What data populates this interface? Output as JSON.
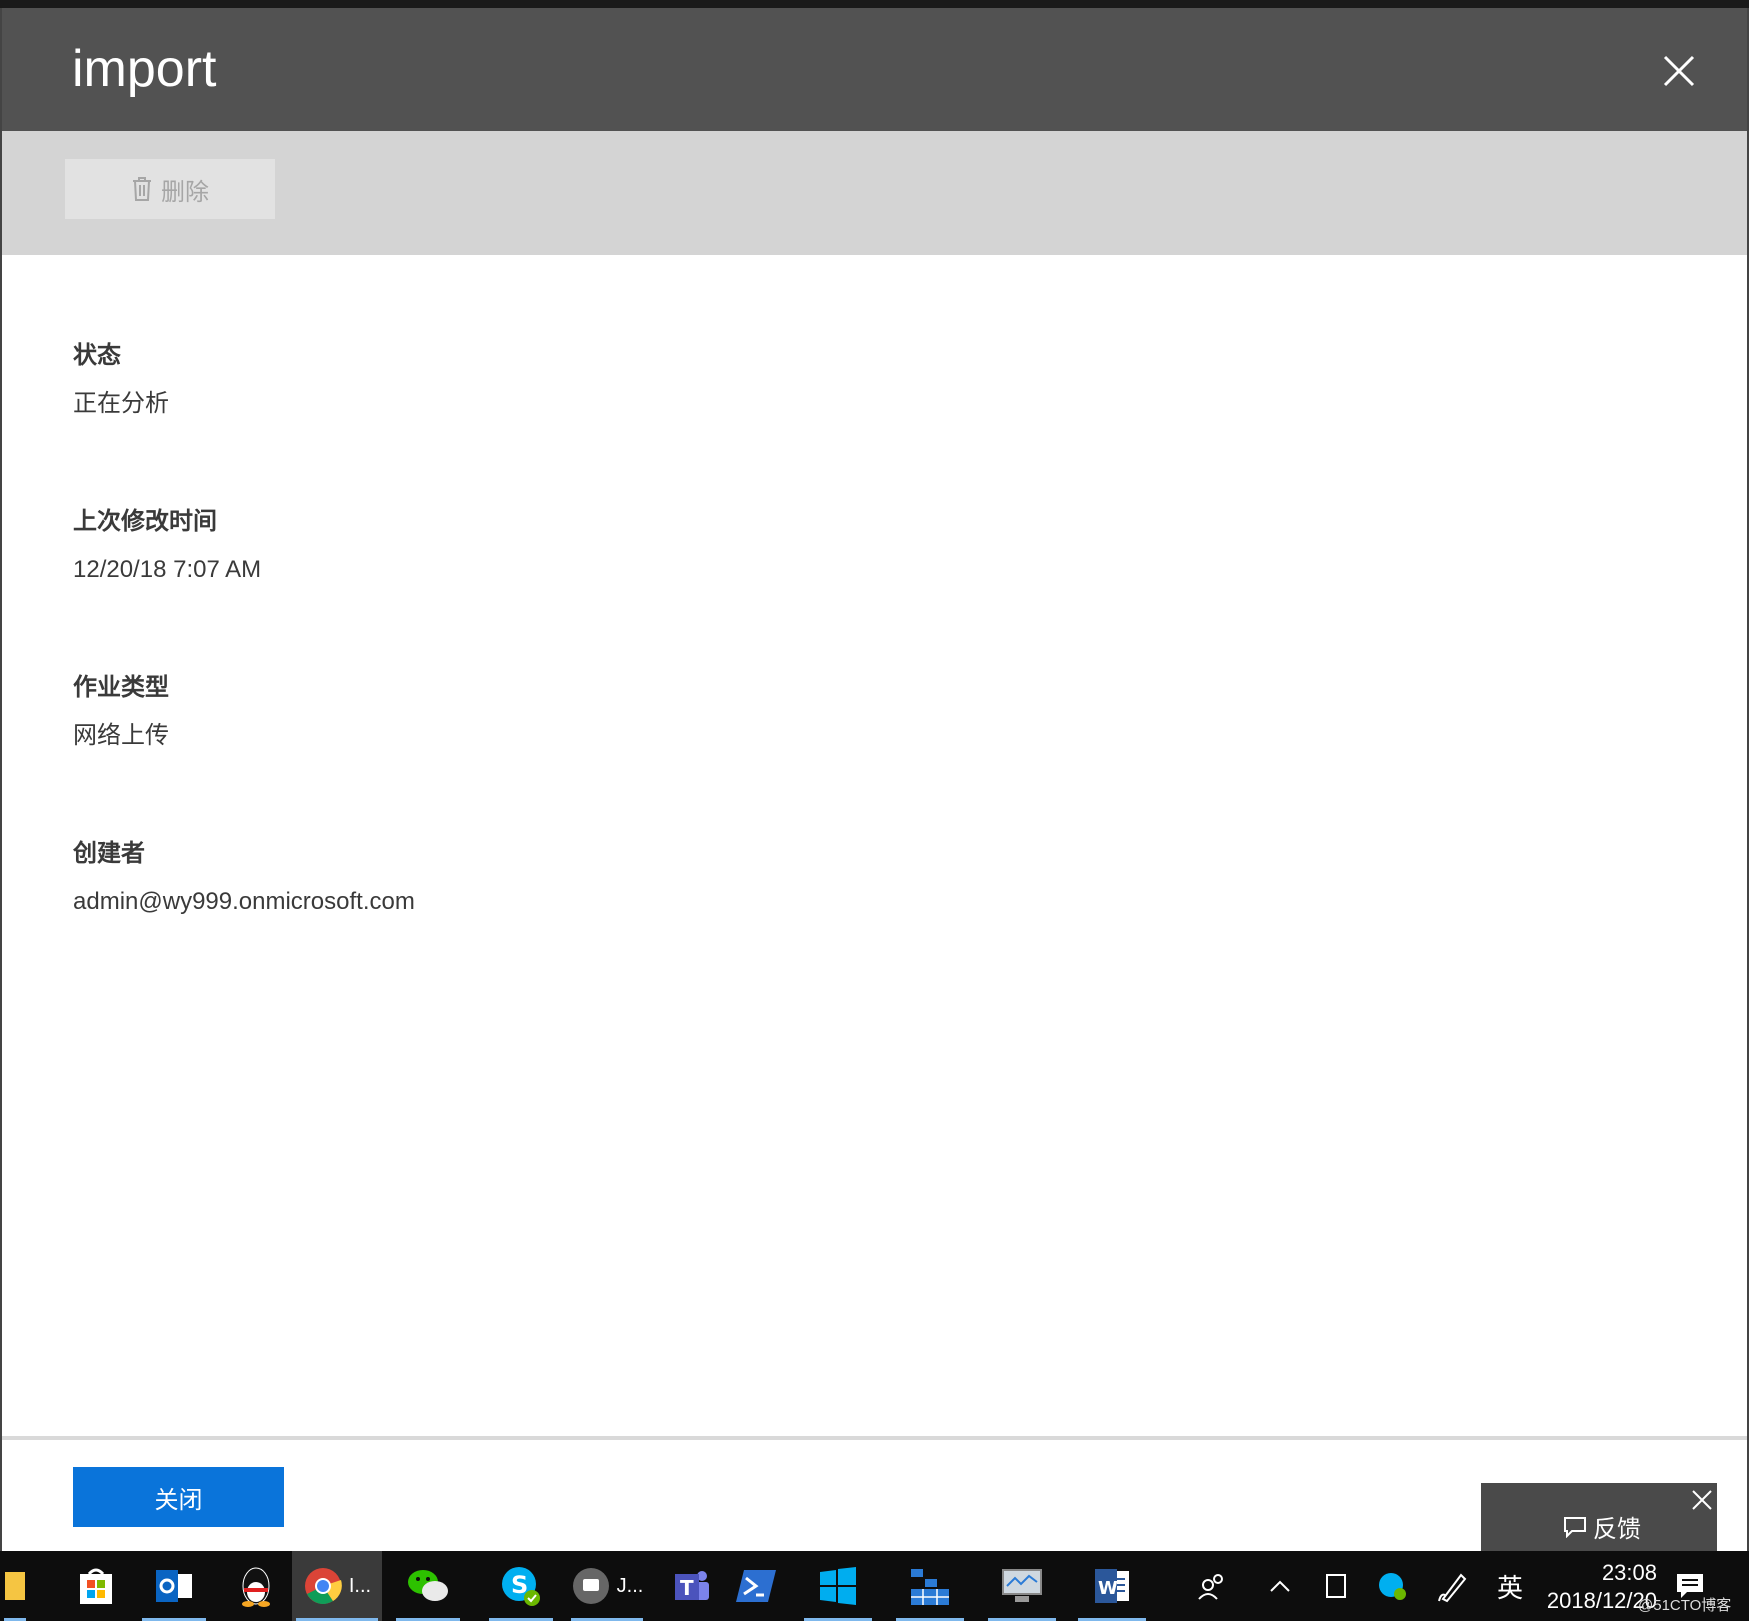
{
  "panel": {
    "title": "import",
    "toolbar": {
      "delete_label": "删除"
    },
    "fields": [
      {
        "label": "状态",
        "value": "正在分析"
      },
      {
        "label": "上次修改时间",
        "value": "12/20/18 7:07 AM"
      },
      {
        "label": "作业类型",
        "value": "网络上传"
      },
      {
        "label": "创建者",
        "value": "admin@wy999.onmicrosoft.com"
      }
    ],
    "close_button_label": "关闭",
    "feedback_label": "反馈"
  },
  "taskbar": {
    "chrome_label": "I...",
    "jabber_label": "J...",
    "ime_label": "英",
    "time": "23:08",
    "date": "2018/12/20"
  },
  "watermark": "@51CTO博客",
  "colors": {
    "header": "#525252",
    "toolbar": "#d4d4d4",
    "primary": "#0a74da",
    "taskbar": "#0d0d0d"
  }
}
